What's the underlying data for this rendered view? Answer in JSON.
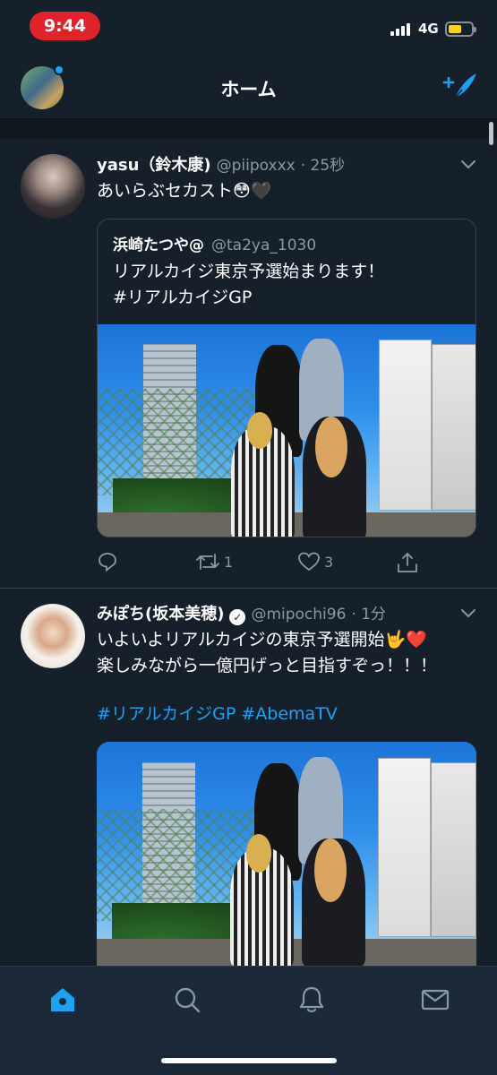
{
  "status_bar": {
    "time": "9:44",
    "network": "4G",
    "battery_fill": 0.6
  },
  "header": {
    "title": "ホーム"
  },
  "tweets": [
    {
      "name": "yasu（鈴木康)",
      "handle": "@piipoxxx",
      "time": "· 25秒",
      "text": "あいらぶセカスト😳🖤",
      "quote": {
        "name": "浜崎たつや@",
        "handle": "@ta2ya_1030",
        "line1": "リアルカイジ東京予選始まります！",
        "line2": "#リアルカイジGP"
      },
      "actions": {
        "reply_count": "",
        "retweet_count": "1",
        "like_count": "3"
      }
    },
    {
      "name": "みぽち(坂本美穂)",
      "handle": "@mipochi96",
      "time": "· 1分",
      "line1": "いよいよリアルカイジの東京予選開始🤟❤️",
      "line2": "楽しみながら一億円げっと目指すぞっ！！！",
      "hashtags": "#リアルカイジGP #AbemaTV"
    }
  ],
  "tabbar": {
    "items": [
      "home",
      "search",
      "notifications",
      "messages"
    ],
    "active": "home"
  },
  "colors": {
    "accent": "#1da1f2",
    "background": "#15202b",
    "muted": "#8899a6",
    "time_pill": "#e0232b"
  },
  "icons": [
    "compose-icon",
    "chevron-down-icon",
    "reply-icon",
    "retweet-icon",
    "like-icon",
    "share-icon",
    "verified-icon",
    "home-icon",
    "search-icon",
    "bell-icon",
    "mail-icon"
  ]
}
